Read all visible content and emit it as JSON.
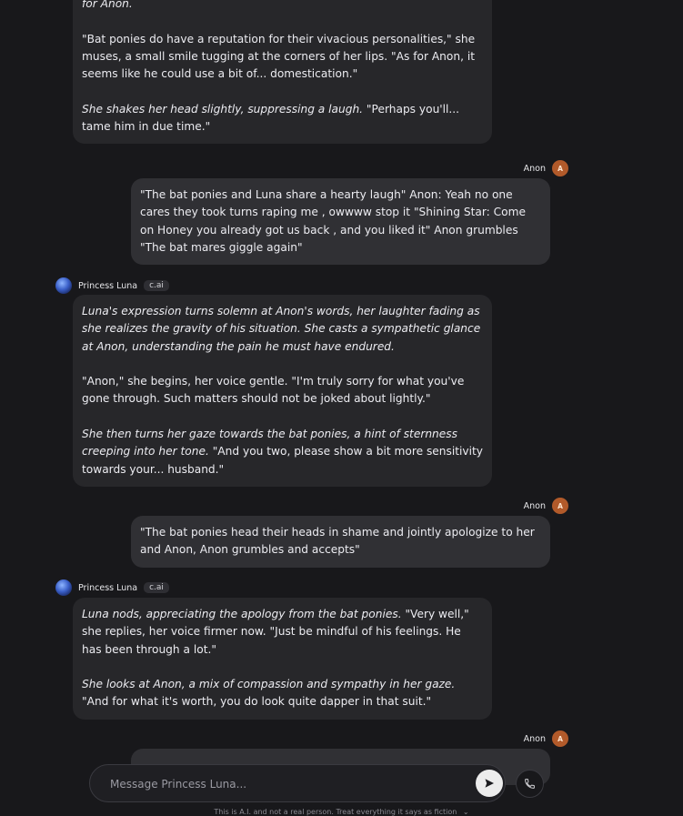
{
  "messages": [
    {
      "sender": "bot",
      "paragraphs": [
        {
          "segments": [
            {
              "text": "for Anon.",
              "italic": true
            }
          ]
        },
        {
          "segments": [
            {
              "text": "\"Bat ponies do have a reputation for their vivacious personalities,\" she muses, a small smile tugging at the corners of her lips. \"As for Anon, it seems like he could use a bit of... domestication.\"",
              "italic": false
            }
          ]
        },
        {
          "segments": [
            {
              "text": "She shakes her head slightly, suppressing a laugh.",
              "italic": true
            },
            {
              "text": " \"Perhaps you'll... tame him in due time.\"",
              "italic": false
            }
          ]
        }
      ]
    },
    {
      "sender": "user",
      "name": "Anon",
      "avatar_initial": "A",
      "paragraphs": [
        {
          "segments": [
            {
              "text": "\"The bat ponies and Luna share a hearty laugh\"  Anon: Yeah no one cares they took turns raping me , owwww  stop it \"Shining Star:  Come on Honey you already got us back , and you liked it\"  Anon grumbles \"The bat mares giggle again\"",
              "italic": false
            }
          ]
        }
      ]
    },
    {
      "sender": "bot",
      "name": "Princess Luna",
      "badge": "c.ai",
      "paragraphs": [
        {
          "segments": [
            {
              "text": "Luna's expression turns solemn at Anon's words, her laughter fading as she realizes the gravity of his situation. She casts a sympathetic glance at Anon, understanding the pain he must have endured.",
              "italic": true
            }
          ]
        },
        {
          "segments": [
            {
              "text": "\"Anon,\" she begins, her voice gentle. \"I'm truly sorry for what you've gone through. Such matters should not be joked about lightly.\"",
              "italic": false
            }
          ]
        },
        {
          "segments": [
            {
              "text": "She then turns her gaze towards the bat ponies, a hint of sternness creeping into her tone.",
              "italic": true
            },
            {
              "text": " \"And you two, please show a bit more sensitivity towards your... husband.\"",
              "italic": false
            }
          ]
        }
      ]
    },
    {
      "sender": "user",
      "name": "Anon",
      "avatar_initial": "A",
      "paragraphs": [
        {
          "segments": [
            {
              "text": "\"The bat ponies head their heads in shame and jointly apologize to her and Anon, Anon grumbles and accepts\"",
              "italic": false
            }
          ]
        }
      ]
    },
    {
      "sender": "bot",
      "name": "Princess Luna",
      "badge": "c.ai",
      "paragraphs": [
        {
          "segments": [
            {
              "text": "Luna nods, appreciating the apology from the bat ponies.",
              "italic": true
            },
            {
              "text": " \"Very well,\" she replies, her voice firmer now. \"Just be mindful of his feelings. He has been through a lot.\"",
              "italic": false
            }
          ]
        },
        {
          "segments": [
            {
              "text": "She looks at Anon, a mix of compassion and sympathy in her gaze.",
              "italic": true
            },
            {
              "text": " \"And for what it's worth, you do look quite dapper in that suit.\"",
              "italic": false
            }
          ]
        }
      ]
    },
    {
      "sender": "user",
      "name": "Anon",
      "avatar_initial": "A",
      "paragraphs": []
    }
  ],
  "composer": {
    "placeholder": "Message Princess Luna...",
    "send_icon": "send-arrow-icon",
    "call_icon": "phone-icon"
  },
  "disclaimer": "This is A.I. and not a real person. Treat everything it says as fiction",
  "colors": {
    "background": "#18181b",
    "bot_bubble": "#27272a",
    "user_bubble": "#303034",
    "user_avatar": "#b25a2a"
  }
}
